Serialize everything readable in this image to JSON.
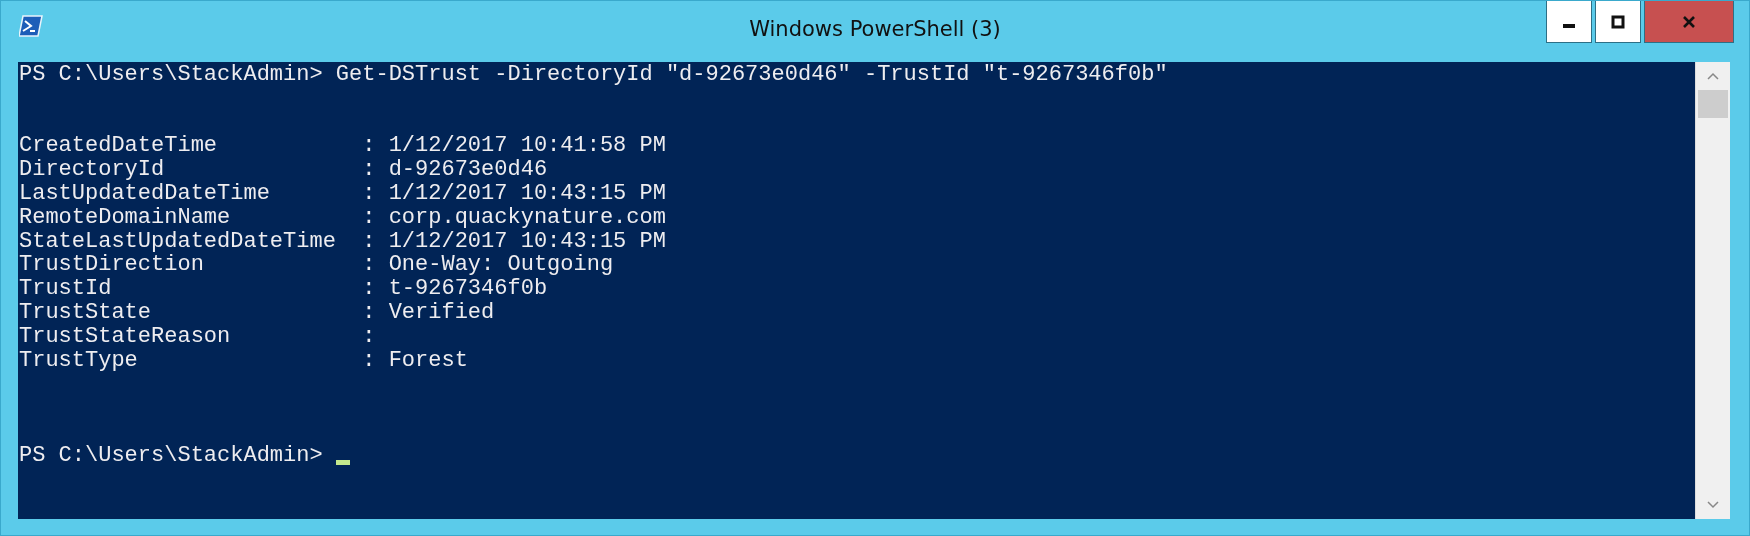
{
  "window": {
    "title": "Windows PowerShell (3)"
  },
  "console": {
    "command_line": "PS C:\\Users\\StackAdmin> Get-DSTrust -DirectoryId \"d-92673e0d46\" -TrustId \"t-9267346f0b\"",
    "output": [
      "CreatedDateTime           : 1/12/2017 10:41:58 PM",
      "DirectoryId               : d-92673e0d46",
      "LastUpdatedDateTime       : 1/12/2017 10:43:15 PM",
      "RemoteDomainName          : corp.quackynature.com",
      "StateLastUpdatedDateTime  : 1/12/2017 10:43:15 PM",
      "TrustDirection            : One-Way: Outgoing",
      "TrustId                   : t-9267346f0b",
      "TrustState                : Verified",
      "TrustStateReason          :",
      "TrustType                 : Forest"
    ],
    "prompt": "PS C:\\Users\\StackAdmin> "
  }
}
